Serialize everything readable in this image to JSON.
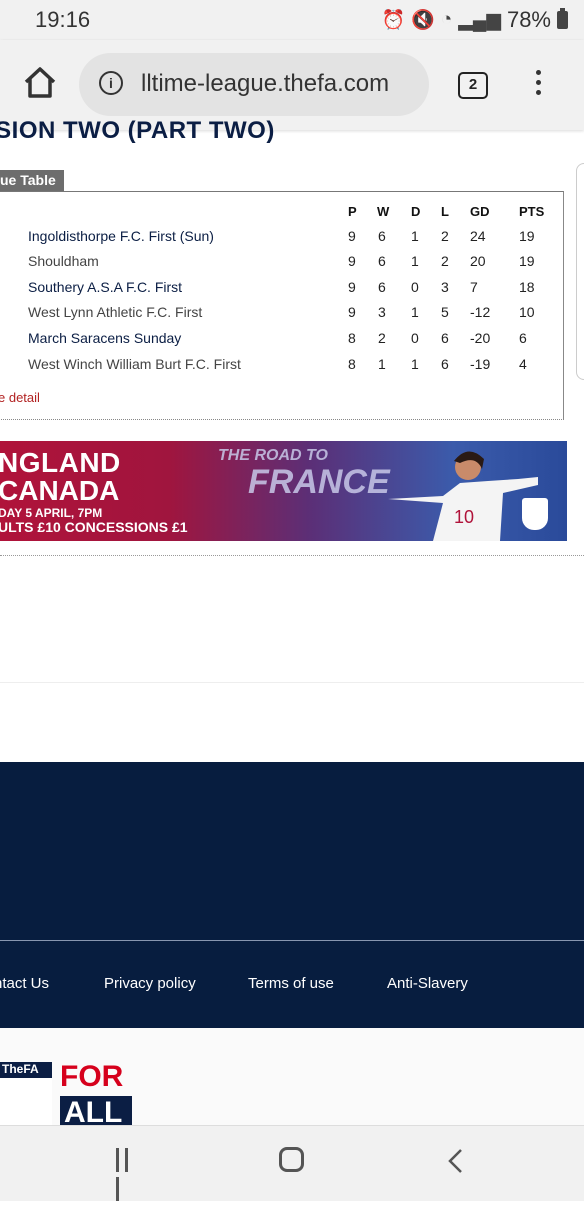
{
  "status": {
    "time": "19:16",
    "battery": "78%"
  },
  "browser": {
    "url": "lltime-league.thefa.com",
    "tab_count": "2"
  },
  "page": {
    "heading": "ISION TWO (PART TWO)",
    "tab_label": "ue Table",
    "more_link": "e detail",
    "columns": [
      "P",
      "W",
      "D",
      "L",
      "GD",
      "PTS"
    ],
    "rows": [
      {
        "team": "Ingoldisthorpe F.C. First (Sun)",
        "p": "9",
        "w": "6",
        "d": "1",
        "l": "2",
        "gd": "24",
        "pts": "19"
      },
      {
        "team": "Shouldham",
        "p": "9",
        "w": "6",
        "d": "1",
        "l": "2",
        "gd": "20",
        "pts": "19"
      },
      {
        "team": "Southery A.S.A F.C. First",
        "p": "9",
        "w": "6",
        "d": "0",
        "l": "3",
        "gd": "7",
        "pts": "18"
      },
      {
        "team": "West Lynn Athletic F.C. First",
        "p": "9",
        "w": "3",
        "d": "1",
        "l": "5",
        "gd": "-12",
        "pts": "10"
      },
      {
        "team": "March Saracens Sunday",
        "p": "8",
        "w": "2",
        "d": "0",
        "l": "6",
        "gd": "-20",
        "pts": "6"
      },
      {
        "team": "West Winch William Burt F.C. First",
        "p": "8",
        "w": "1",
        "d": "1",
        "l": "6",
        "gd": "-19",
        "pts": "4"
      }
    ]
  },
  "banner": {
    "line1": "NGLAND",
    "line2": "CANADA",
    "line3": "DAY 5 APRIL, 7PM",
    "line4": "ULTS £10  CONCESSIONS £1",
    "road": "THE ROAD TO",
    "france": "FRANCE",
    "shirt_number": "10"
  },
  "footer": {
    "links": [
      "ntact Us",
      "Privacy policy",
      "Terms of use",
      "Anti-Slavery"
    ]
  },
  "bottom": {
    "badge": "TheFA",
    "for": "FOR",
    "all": "ALL"
  },
  "colors": {
    "navy": "#071d3f",
    "red": "#d6001c",
    "banner_red": "#b0133a"
  }
}
